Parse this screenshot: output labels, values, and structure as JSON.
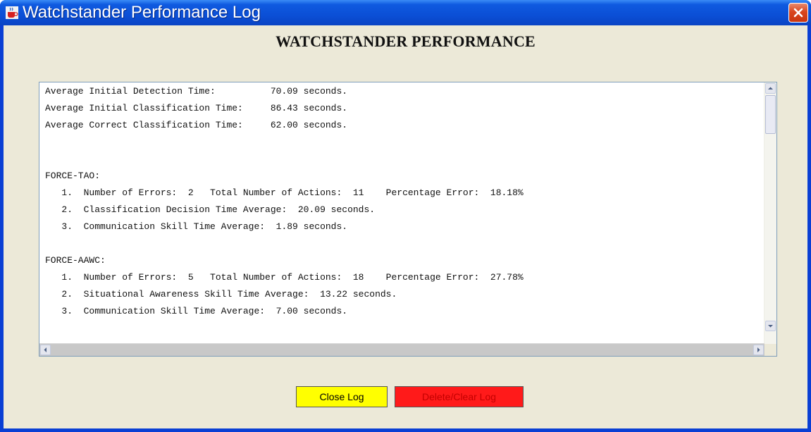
{
  "window": {
    "title": "Watchstander Performance Log",
    "app_icon": "java-cup-icon",
    "close_icon": "close-icon"
  },
  "heading": "WATCHSTANDER PERFORMANCE",
  "log": {
    "lines": [
      "Average Initial Detection Time:          70.09 seconds.",
      "Average Initial Classification Time:     86.43 seconds.",
      "Average Correct Classification Time:     62.00 seconds.",
      "",
      "",
      "FORCE-TAO:",
      "   1.  Number of Errors:  2   Total Number of Actions:  11    Percentage Error:  18.18%",
      "   2.  Classification Decision Time Average:  20.09 seconds.",
      "   3.  Communication Skill Time Average:  1.89 seconds.",
      "",
      "FORCE-AAWC:",
      "   1.  Number of Errors:  5   Total Number of Actions:  18    Percentage Error:  27.78%",
      "   2.  Situational Awareness Skill Time Average:  13.22 seconds.",
      "   3.  Communication Skill Time Average:  7.00 seconds."
    ]
  },
  "buttons": {
    "close_log": "Close Log",
    "delete_clear_log": "Delete/Clear Log"
  },
  "colors": {
    "titlebar": "#0b4fd6",
    "client_bg": "#ece9d8",
    "close_log_bg": "#ffff00",
    "delete_log_bg": "#ff1a1a",
    "delete_log_text": "#c40000"
  }
}
